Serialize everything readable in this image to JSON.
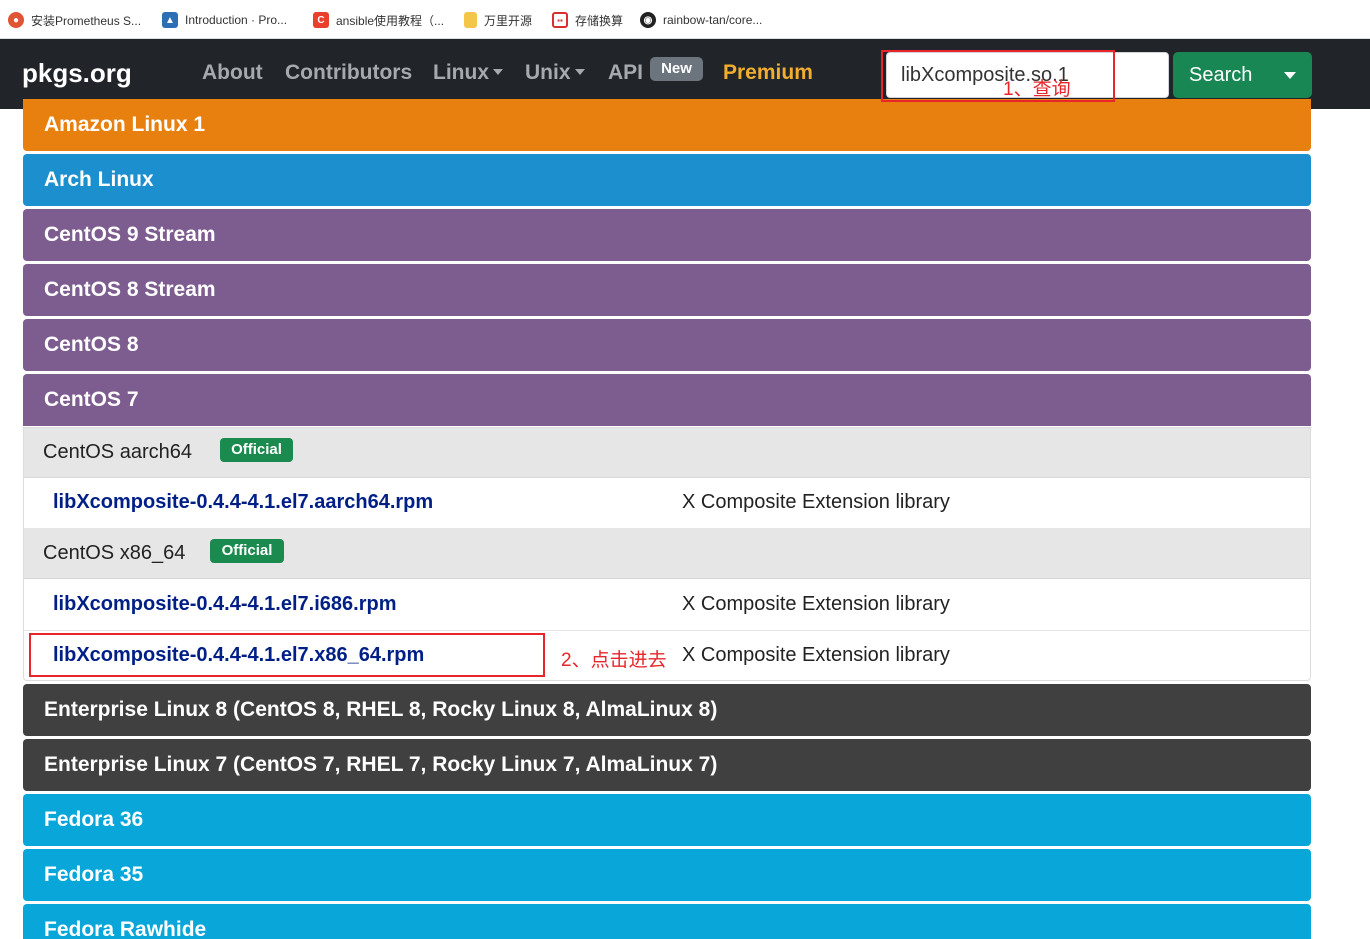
{
  "bookmarks": [
    {
      "label": "安装Prometheus S...",
      "icon": "prometheus-icon",
      "color": "#e05533"
    },
    {
      "label": "Introduction · Pro...",
      "icon": "docs-icon",
      "color": "#2b6fb5"
    },
    {
      "label": "ansible使用教程（...",
      "icon": "csdn-icon",
      "color": "#e8402b"
    },
    {
      "label": "万里开源",
      "icon": "folder-icon",
      "color": "#f3c649"
    },
    {
      "label": "存储换算",
      "icon": "calc-icon",
      "color": "#d92f2f"
    },
    {
      "label": "rainbow-tan/core...",
      "icon": "github-icon",
      "color": "#222222"
    }
  ],
  "navbar": {
    "brand": "pkgs.org",
    "about": "About",
    "contributors": "Contributors",
    "linux": "Linux",
    "unix": "Unix",
    "api": "API",
    "api_badge": "New",
    "premium": "Premium",
    "search_value": "libXcomposite.so.1",
    "search_button": "Search"
  },
  "distros_top": [
    {
      "name": "Amazon Linux 1",
      "style": "amazon"
    },
    {
      "name": "Arch Linux",
      "style": "arch"
    },
    {
      "name": "CentOS 9 Stream",
      "style": "centos"
    },
    {
      "name": "CentOS 8 Stream",
      "style": "centos"
    },
    {
      "name": "CentOS 8",
      "style": "centos"
    },
    {
      "name": "CentOS 7",
      "style": "centos"
    }
  ],
  "centos7_panel": {
    "groups": [
      {
        "title": "CentOS aarch64",
        "badge": "Official",
        "packages": [
          {
            "name": "libXcomposite-0.4.4-4.1.el7.aarch64.rpm",
            "description": "X Composite Extension library"
          }
        ]
      },
      {
        "title": "CentOS x86_64",
        "badge": "Official",
        "packages": [
          {
            "name": "libXcomposite-0.4.4-4.1.el7.i686.rpm",
            "description": "X Composite Extension library"
          },
          {
            "name": "libXcomposite-0.4.4-4.1.el7.x86_64.rpm",
            "description": "X Composite Extension library"
          }
        ]
      }
    ]
  },
  "distros_bottom": [
    {
      "name": "Enterprise Linux 8 (CentOS 8, RHEL 8, Rocky Linux 8, AlmaLinux 8)",
      "style": "el"
    },
    {
      "name": "Enterprise Linux 7 (CentOS 7, RHEL 7, Rocky Linux 7, AlmaLinux 7)",
      "style": "el"
    },
    {
      "name": "Fedora 36",
      "style": "fedora"
    },
    {
      "name": "Fedora 35",
      "style": "fedora"
    },
    {
      "name": "Fedora Rawhide",
      "style": "fedora"
    }
  ],
  "annotations": {
    "step1": "1、查询",
    "step2": "2、点击进去"
  },
  "colors": {
    "amazon": "#e8800f",
    "arch": "#1c8fcf",
    "centos": "#7d5d8f",
    "enterprise": "#404040",
    "fedora": "#08a6d9",
    "premium": "#f0ad2e",
    "search_button": "#198754",
    "annotation": "#e8252b"
  }
}
